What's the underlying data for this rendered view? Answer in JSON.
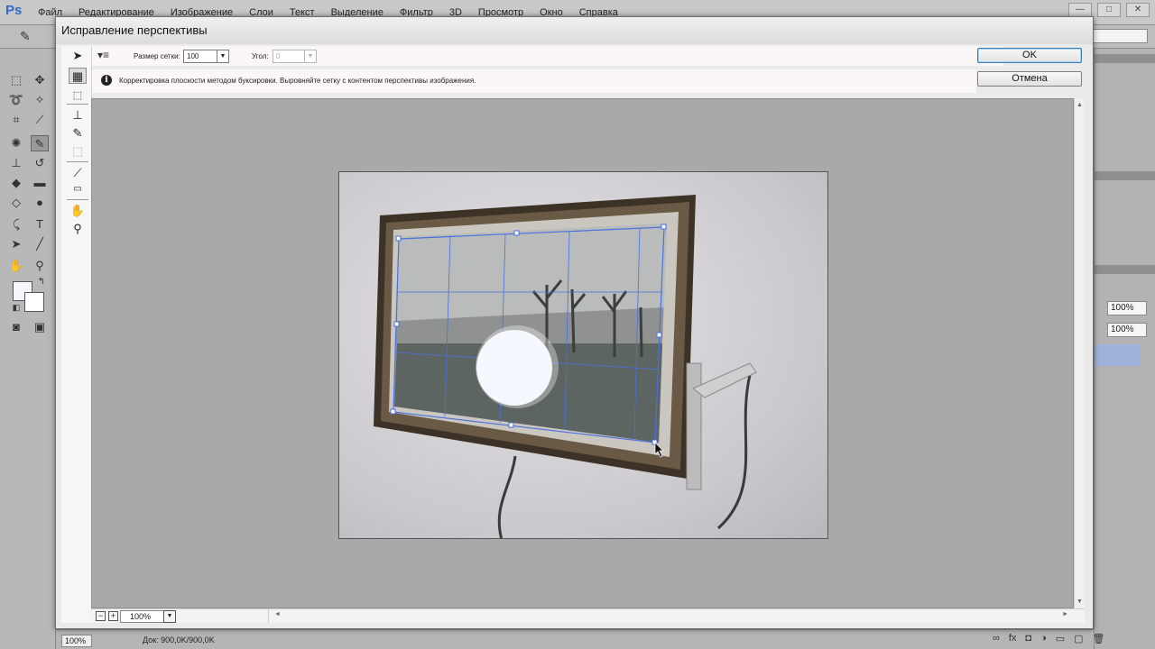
{
  "app": {
    "logo": "Ps",
    "menu": [
      "Файл",
      "Редактирование",
      "Изображение",
      "Слои",
      "Текст",
      "Выделение",
      "Фильтр",
      "3D",
      "Просмотр",
      "Окно",
      "Справка"
    ],
    "window_buttons": [
      "—",
      "□",
      "✕"
    ]
  },
  "dialog": {
    "title": "Исправление перспективы",
    "grid_size_label": "Размер сетки:",
    "grid_size_value": "100",
    "angle_label": "Угол:",
    "angle_value": "0",
    "info_text": "Корректировка плоскости методом буксировки. Выровняйте сетку с контентом перспективы изображения.",
    "ok_label": "OK",
    "cancel_label": "Отмена",
    "zoom_value": "100%"
  },
  "right_panel": {
    "opacity_value": "100%",
    "fill_value": "100%"
  },
  "status": {
    "zoom": "100%",
    "doc_info": "Док: 900,0K/900,0K"
  },
  "icons": {
    "info": "info-icon",
    "tools": [
      "edit-plane-tool-icon",
      "create-plane-tool-icon",
      "marquee-tool-icon",
      "stamp-tool-icon",
      "brush-tool-icon",
      "transform-tool-icon",
      "eyedropper-tool-icon",
      "ruler-tool-icon",
      "hand-tool-icon",
      "zoom-tool-icon"
    ]
  }
}
